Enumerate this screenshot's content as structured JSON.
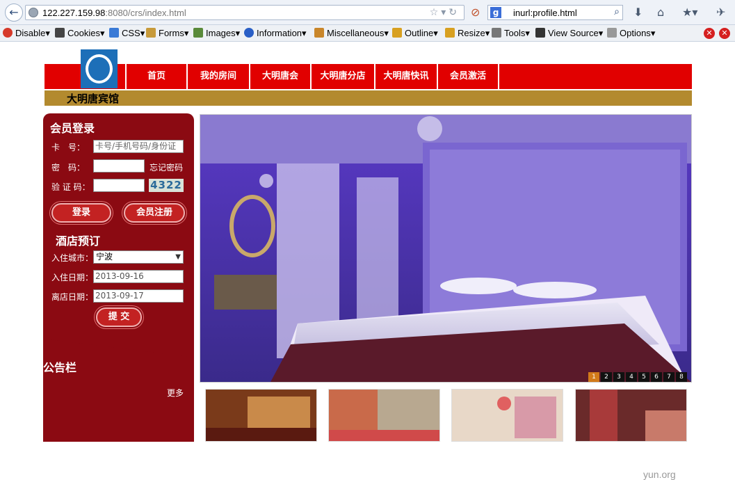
{
  "browser": {
    "url_host": "122.227.159.98",
    "url_path": ":8080/crs/index.html",
    "search_value": "inurl:profile.html",
    "search_engine_glyph": "g"
  },
  "devtoolbar": {
    "items": [
      "Disable",
      "Cookies",
      "CSS",
      "Forms",
      "Images",
      "Information",
      "Miscellaneous",
      "Outline",
      "Resize",
      "Tools",
      "View Source",
      "Options"
    ]
  },
  "site": {
    "nav": [
      "首页",
      "我的房间",
      "大明唐会",
      "大明唐分店",
      "大明唐快讯",
      "会员激活"
    ],
    "hotel_name": "大明唐宾馆",
    "accent": "#e10000",
    "panel_color": "#8b0a12",
    "gold": "#b38a2e"
  },
  "login": {
    "title": "会员登录",
    "card_label": "卡　号：",
    "card_placeholder": "卡号/手机号码/身份证",
    "password_label": "密　码：",
    "forgot": "忘记密码",
    "captcha_label": "验 证 码：",
    "captcha_code": "4322",
    "login_btn": "登录",
    "register_btn": "会员注册"
  },
  "booking": {
    "title": "酒店预订",
    "city_label": "入住城市：",
    "city_value": "宁波",
    "checkin_label": "入住日期：",
    "checkin_value": "2013-09-16",
    "checkout_label": "离店日期：",
    "checkout_value": "2013-09-17",
    "submit_btn": "提 交"
  },
  "notice": {
    "title": "公告栏",
    "more": "更多"
  },
  "slider": {
    "numbers": [
      "1",
      "2",
      "3",
      "4",
      "5",
      "6",
      "7",
      "8"
    ],
    "active": "1"
  },
  "footer_watermark": "yun.org"
}
